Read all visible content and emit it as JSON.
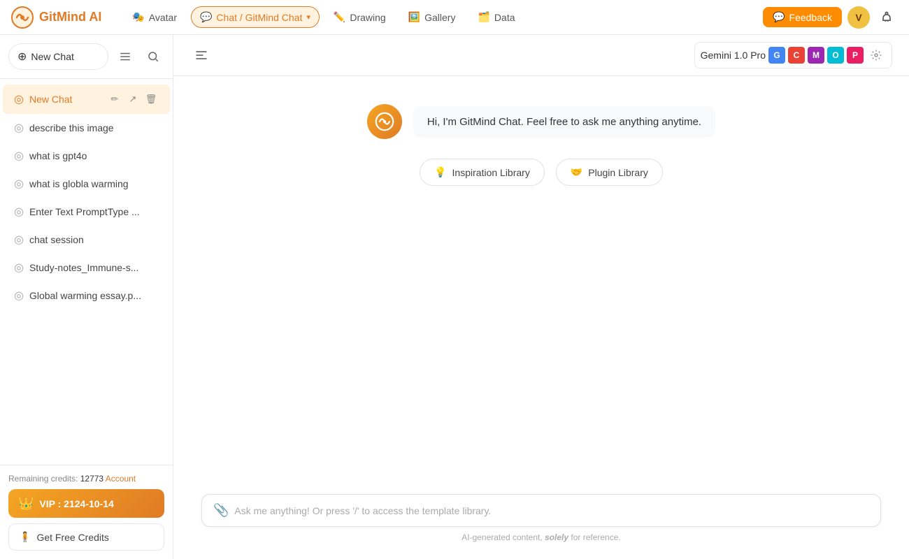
{
  "app": {
    "name": "GitMind AI"
  },
  "topnav": {
    "logo_text": "GitMind AI",
    "items": [
      {
        "id": "avatar",
        "label": "Avatar",
        "icon": "🎭"
      },
      {
        "id": "chat",
        "label": "Chat / GitMind Chat",
        "icon": "💬",
        "active": true
      },
      {
        "id": "drawing",
        "label": "Drawing",
        "icon": "✏️"
      },
      {
        "id": "gallery",
        "label": "Gallery",
        "icon": "🖼️"
      },
      {
        "id": "data",
        "label": "Data",
        "icon": "🗂️"
      }
    ],
    "feedback_label": "Feedback",
    "user_initial": "V"
  },
  "sidebar": {
    "new_chat_label": "New Chat",
    "chat_items": [
      {
        "id": "new-chat",
        "label": "New Chat",
        "active": true
      },
      {
        "id": "describe-image",
        "label": "describe this image"
      },
      {
        "id": "what-gpt4o",
        "label": "what is gpt4o"
      },
      {
        "id": "global-warming",
        "label": "what is globla warming"
      },
      {
        "id": "enter-text",
        "label": "Enter Text PromptType ..."
      },
      {
        "id": "chat-session",
        "label": "chat session"
      },
      {
        "id": "study-notes",
        "label": "Study-notes_Immune-s..."
      },
      {
        "id": "global-essay",
        "label": "Global warming essay.p..."
      }
    ],
    "credits_label": "Remaining credits: ",
    "credits_count": "12773",
    "account_label": "Account",
    "vip_label": "VIP : 2124-10-14",
    "free_credits_label": "Get Free Credits"
  },
  "chat_header": {
    "model_name": "Gemini 1.0 Pro"
  },
  "chat": {
    "greeting": "Hi, I'm GitMind Chat. Feel free to ask me anything anytime.",
    "inspiration_label": "Inspiration Library",
    "plugin_label": "Plugin Library",
    "input_placeholder": "Ask me anything! Or press '/' to access the template library.",
    "footer_text": "AI-generated content, solely for reference."
  }
}
